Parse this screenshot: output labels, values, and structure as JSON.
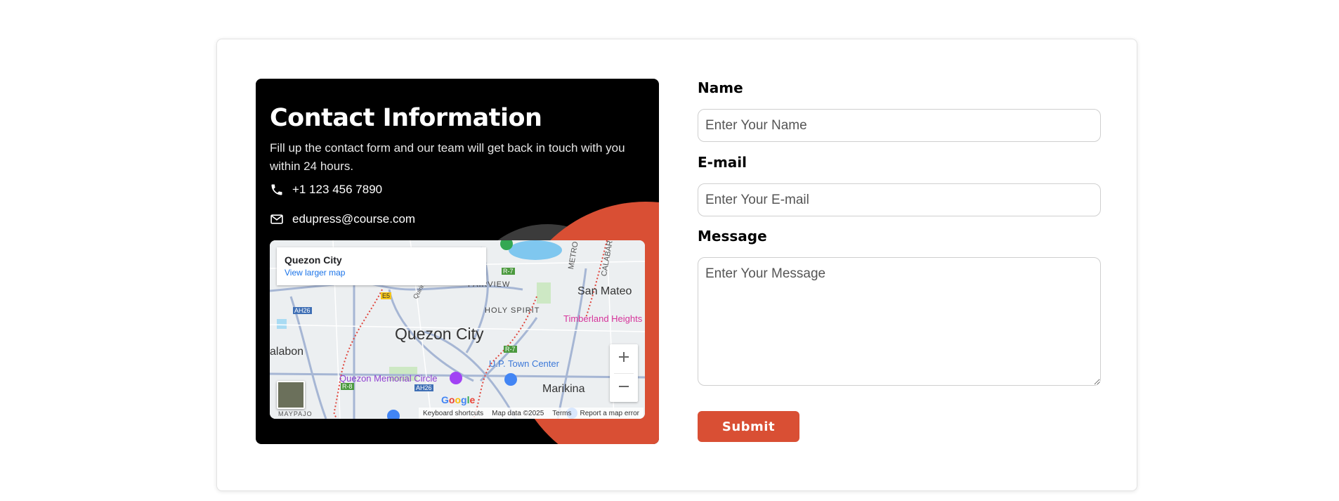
{
  "colors": {
    "accent": "#d94f34",
    "panel": "#000000",
    "link": "#1a73e8"
  },
  "contact": {
    "title": "Contact Information",
    "text": "Fill up the contact form and our team will get back in touch with you within 24 hours.",
    "phone": {
      "icon": "phone-icon",
      "value": "+1 123 456 7890"
    },
    "email": {
      "icon": "mail-icon",
      "value": "edupress@course.com"
    }
  },
  "map": {
    "place": "Quezon City",
    "larger_link": "View larger map",
    "labels": {
      "quezon_city": "Quezon City",
      "san_mateo": "San Mateo",
      "fairview": "FAIRVIEW",
      "holy_spirit": "HOLY SPIRIT",
      "timberland": "Timberland Heights",
      "malabon": "alabon",
      "memorial_circle": "Quezon Memorial Circle",
      "up_town": "U.P. Town Center",
      "marikina": "Marikina",
      "metro": "METRO M",
      "calabar": "CALABAR",
      "maypajo": "MAYPAJO",
      "quirino": "Quirino H",
      "r7a": "R-7",
      "r7b": "R-7",
      "e5": "E5",
      "ah26a": "AH26",
      "ah26b": "AH26",
      "r8": "R-8"
    },
    "zoom_in": "+",
    "zoom_out": "−",
    "google": "Google",
    "attribution": {
      "shortcuts": "Keyboard shortcuts",
      "data": "Map data ©2025",
      "terms": "Terms",
      "report": "Report a map error"
    }
  },
  "form": {
    "name": {
      "label": "Name",
      "placeholder": "Enter Your Name"
    },
    "email": {
      "label": "E-mail",
      "placeholder": "Enter Your E-mail"
    },
    "message": {
      "label": "Message",
      "placeholder": "Enter Your Message"
    },
    "submit": "Submit"
  }
}
